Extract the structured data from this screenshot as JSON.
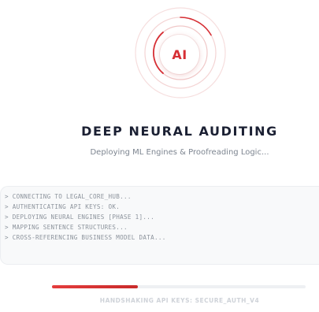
{
  "loader": {
    "badge_text": "AI",
    "accent_color": "#d62f35"
  },
  "heading": {
    "title": "DEEP NEURAL AUDITING",
    "subtitle": "Deploying ML Engines & Proofreading Logic..."
  },
  "console": {
    "lines": [
      "> CONNECTING TO LEGAL_CORE_HUB...",
      "> AUTHENTICATING API KEYS: OK.",
      "> DEPLOYING NEURAL ENGINES [PHASE 1]...",
      "> MAPPING SENTENCE STRUCTURES...",
      "> CROSS-REFERENCING BUSINESS MODEL DATA..."
    ]
  },
  "progress": {
    "fraction": 0.34,
    "status_text": "HANDSHAKING API KEYS: SECURE_AUTH_V4"
  }
}
